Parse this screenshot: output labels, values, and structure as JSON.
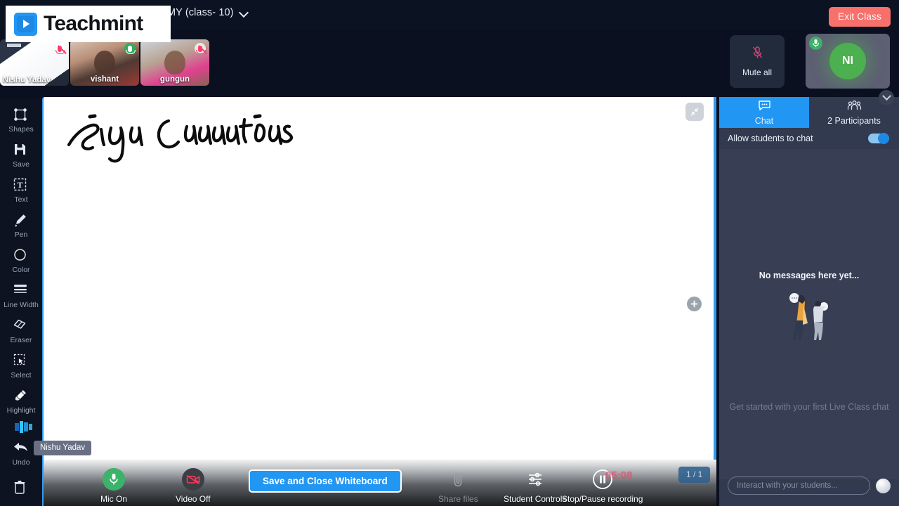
{
  "header": {
    "class_title": "MY (class- 10)",
    "dropdown_icon": "chevron-down-icon",
    "exit_label": "Exit Class"
  },
  "logo": {
    "brand": "Teachmint",
    "icon": "teachmint-logo-icon"
  },
  "video_tiles": [
    {
      "name": "Nishu Yadav",
      "mic_icon": "mic-muted-icon",
      "mic_state": "muted"
    },
    {
      "name": "vishant",
      "mic_icon": "mic-on-icon",
      "mic_state": "on"
    },
    {
      "name": "gungun",
      "mic_icon": "mic-muted-icon",
      "mic_state": "muted"
    }
  ],
  "mute_all": {
    "label": "Mute all",
    "icon": "mic-muted-icon"
  },
  "presenter": {
    "initials": "NI",
    "mic_icon": "mic-on-icon",
    "accent": "#4caf50"
  },
  "tools": [
    {
      "label": "Shapes",
      "icon": "shapes-icon"
    },
    {
      "label": "Save",
      "icon": "floppy-save-icon"
    },
    {
      "label": "Text",
      "icon": "text-box-icon"
    },
    {
      "label": "Pen",
      "icon": "pen-icon"
    },
    {
      "label": "Color",
      "icon": "color-circle-icon"
    },
    {
      "label": "Line Width",
      "icon": "line-width-icon"
    },
    {
      "label": "Eraser",
      "icon": "eraser-icon"
    },
    {
      "label": "Select",
      "icon": "select-cursor-icon"
    },
    {
      "label": "Highlight",
      "icon": "highlighter-icon"
    },
    {
      "label": "Undo",
      "icon": "undo-arrow-icon"
    },
    {
      "label": "",
      "icon": "trash-icon"
    }
  ],
  "rail_nametag": "Nishu Yadav",
  "whiteboard": {
    "ink_text": "Sign Conventions",
    "shrink_icon": "collapse-arrows-icon",
    "add_icon": "plus-circle-icon"
  },
  "bottom_bar": {
    "mic": {
      "label": "Mic On",
      "icon": "mic-on-icon",
      "color": "#3bb36a"
    },
    "video": {
      "label": "Video Off",
      "icon": "video-off-icon",
      "color": "#ff3b5c"
    },
    "save_close_label": "Save and Close Whiteboard",
    "share_files": {
      "label": "Share files",
      "icon": "paperclip-icon"
    },
    "student_controls": {
      "label": "Student Controls",
      "icon": "sliders-icon"
    },
    "recording": {
      "label": "Stop/Pause recording",
      "icon": "pause-circle-icon",
      "timer": "05:08"
    },
    "page_indicator": "1 / 1"
  },
  "chat_panel": {
    "tabs": [
      {
        "label": "Chat",
        "icon": "chat-bubble-icon",
        "active": true
      },
      {
        "label": "2 Participants",
        "icon": "people-icon",
        "active": false
      }
    ],
    "allow_students_label": "Allow students to chat",
    "allow_students_on": true,
    "empty_title": "No messages here yet...",
    "empty_subtitle": "Get started with your first Live Class chat",
    "input_placeholder": "Interact with your students...",
    "send_icon": "send-icon",
    "collapse_icon": "chevron-down-icon"
  },
  "colors": {
    "accent_blue": "#2196f3",
    "exit_red": "#f8706c",
    "panel_bg": "#313a4f",
    "rail_bg": "#0d1320"
  }
}
